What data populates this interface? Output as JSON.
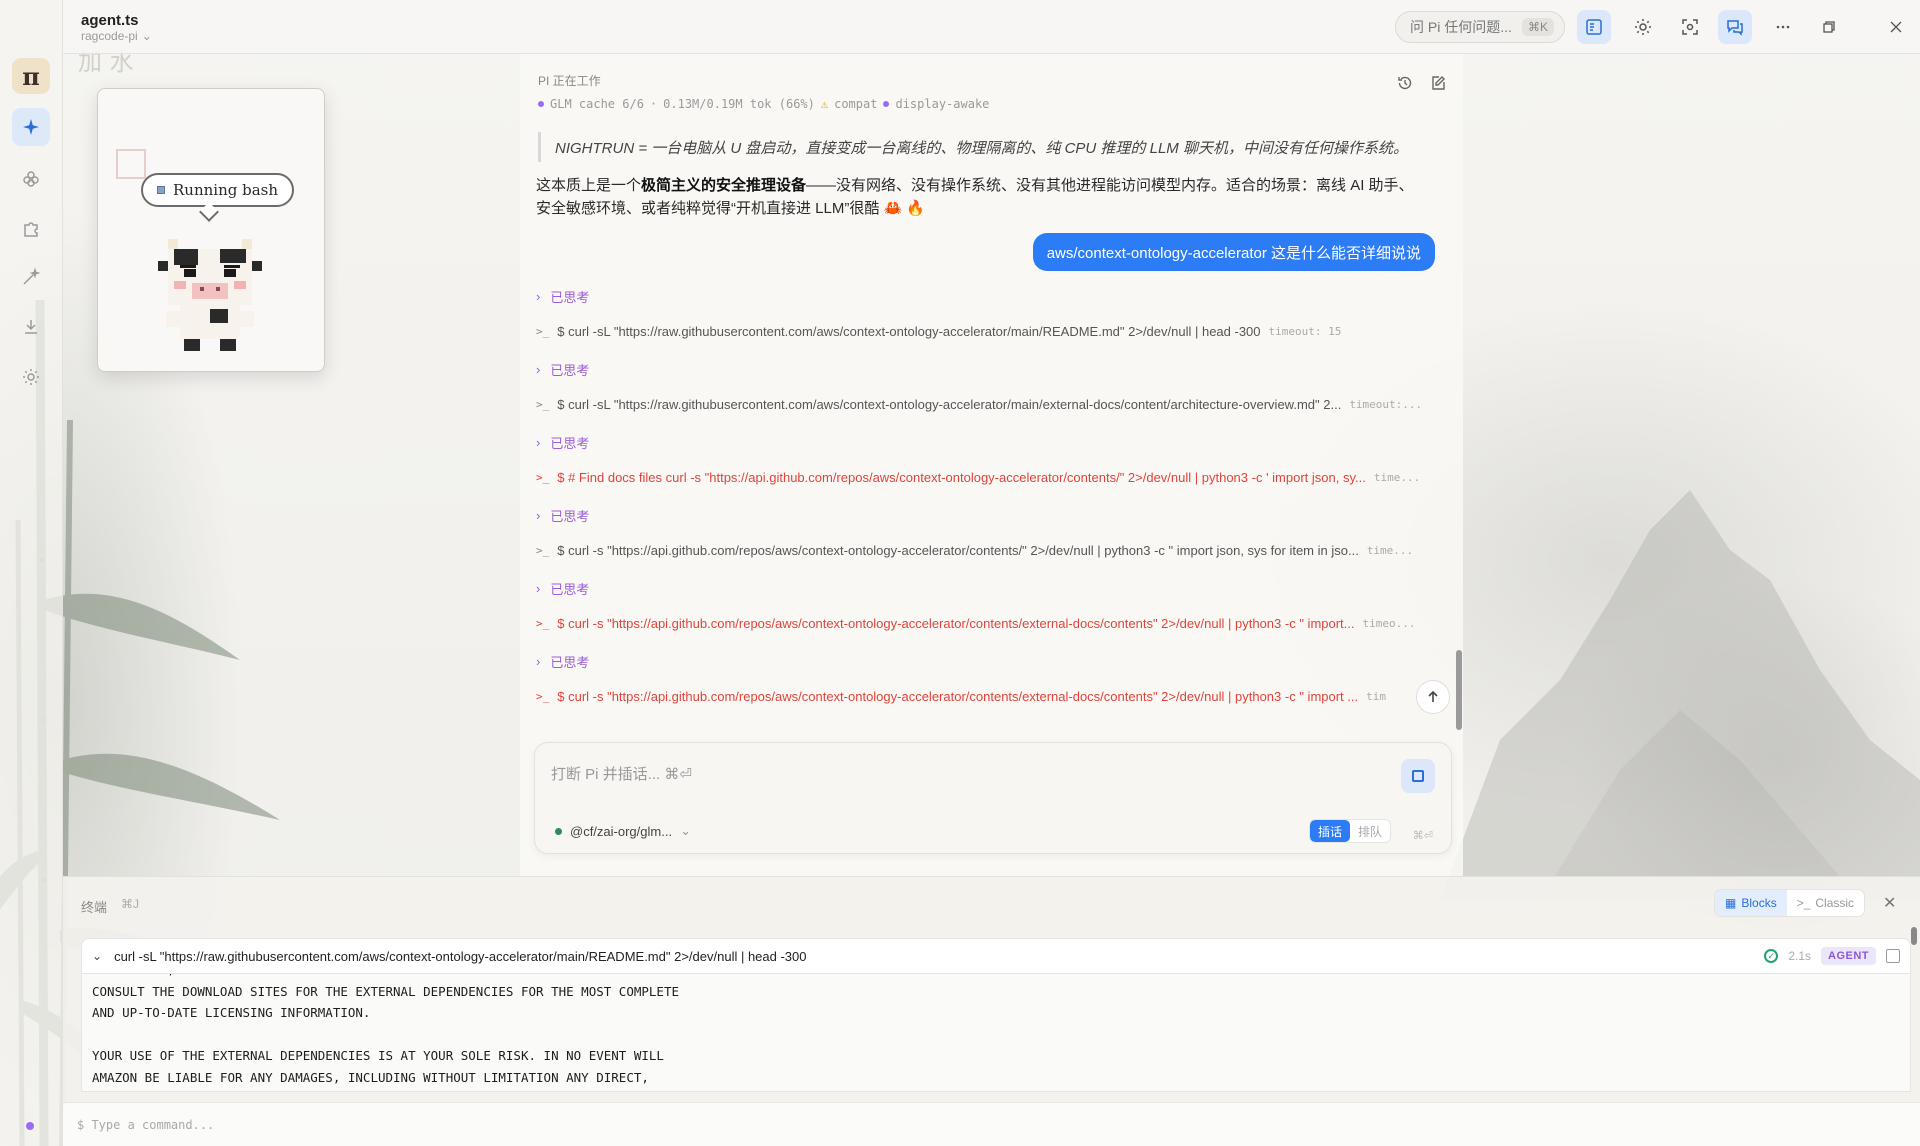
{
  "header": {
    "file_title": "agent.ts",
    "file_subtitle": "ragcode-pi",
    "ask_pi_placeholder": "问 Pi 任何问题...",
    "ask_pi_shortcut": "⌘K"
  },
  "rail": {
    "logo": "π",
    "icons": [
      "sparkle-icon",
      "flower-icon",
      "puzzle-icon",
      "wand-icon",
      "download-icon",
      "gear-icon"
    ]
  },
  "pet": {
    "bubble_text": "Running bash"
  },
  "chat": {
    "status_title": "PI 正在工作",
    "status_meta": {
      "model_cache": "GLM cache 6/6",
      "tokens": "0.13M/0.19M tok (66%)",
      "compat": "compat",
      "display": "display-awake"
    },
    "quote": "NIGHTRUN = 一台电脑从 U 盘启动，直接变成一台离线的、物理隔离的、纯 CPU 推理的 LLM 聊天机，中间没有任何操作系统。",
    "para_pre": "这本质上是一个",
    "para_bold": "极简主义的安全推理设备",
    "para_post": "——没有网络、没有操作系统、没有其他进程能访问模型内存。适合的场景：离线 AI 助手、安全敏感环境、或者纯粹觉得“开机直接进 LLM”很酷 🦀 🔥",
    "user_message": "aws/context-ontology-accelerator 这是什么能否详细说说",
    "thinking_label": "已思考",
    "commands": [
      {
        "text": "$ curl -sL \"https://raw.githubusercontent.com/aws/context-ontology-accelerator/main/README.md\" 2>/dev/null | head -300",
        "meta": "timeout: 15",
        "error": false
      },
      {
        "text": "$ curl -sL \"https://raw.githubusercontent.com/aws/context-ontology-accelerator/main/external-docs/content/architecture-overview.md\" 2...",
        "meta": "timeout:...",
        "error": false
      },
      {
        "text": "$ # Find docs files curl -s \"https://api.github.com/repos/aws/context-ontology-accelerator/contents/\" 2>/dev/null | python3 -c ' import json, sy...",
        "meta": "time...",
        "error": true
      },
      {
        "text": "$ curl -s \"https://api.github.com/repos/aws/context-ontology-accelerator/contents/\" 2>/dev/null | python3 -c \" import json, sys for item in jso...",
        "meta": "time...",
        "error": false
      },
      {
        "text": "$ curl -s \"https://api.github.com/repos/aws/context-ontology-accelerator/contents/external-docs/contents\" 2>/dev/null | python3 -c \" import...",
        "meta": "timeo...",
        "error": true
      },
      {
        "text": "$ curl -s \"https://api.github.com/repos/aws/context-ontology-accelerator/contents/external-docs/contents\" 2>/dev/null | python3 -c \" import ...",
        "meta": "tim",
        "error": true
      }
    ],
    "composer": {
      "placeholder": "打断 Pi 并插话... ⌘⏎",
      "model": "@cf/zai-org/glm...",
      "mode_interject": "插话",
      "mode_queue": "排队",
      "enter_hint": "⌘⏎"
    }
  },
  "terminal": {
    "title": "终端",
    "shortcut": "⌘J",
    "view_blocks": "Blocks",
    "view_classic": "Classic",
    "block_command": "curl -sL \"https://raw.githubusercontent.com/aws/context-ontology-accelerator/main/README.md\" 2>/dev/null | head -300",
    "block_duration": "2.1s",
    "block_badge": "AGENT",
    "output_lines": [
      "UP TO DATE, AND AMAZON WILL HAVE NO LIABILITY FOR ANY INACCURACIES. YOU SHOULD",
      "CONSULT THE DOWNLOAD SITES FOR THE EXTERNAL DEPENDENCIES FOR THE MOST COMPLETE",
      "AND UP-TO-DATE LICENSING INFORMATION.",
      "",
      "YOUR USE OF THE EXTERNAL DEPENDENCIES IS AT YOUR SOLE RISK. IN NO EVENT WILL",
      "AMAZON BE LIABLE FOR ANY DAMAGES, INCLUDING WITHOUT LIMITATION ANY DIRECT,"
    ],
    "input_placeholder": "$ Type a command..."
  },
  "colors": {
    "accent": "#2c7cf6",
    "thinking": "#9b5ed8",
    "error": "#e0443b",
    "success": "#22a36b"
  }
}
